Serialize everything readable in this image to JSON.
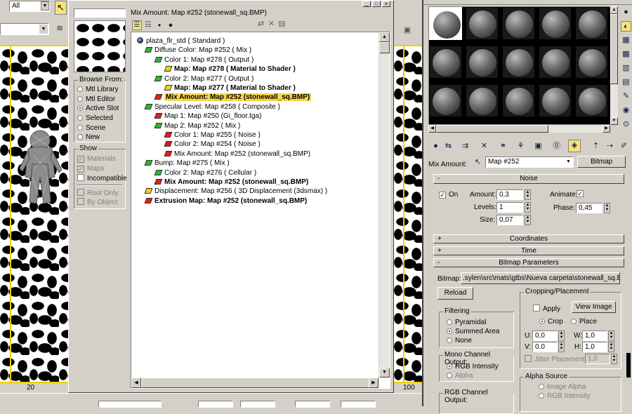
{
  "viewport_toolbar": {
    "filter_value": "All"
  },
  "viewport_left": {
    "ruler_label": "20"
  },
  "viewport_right": {
    "ruler_label": "100"
  },
  "browser": {
    "title": "Mix Amount: Map #252 (stonewall_sq.BMP)",
    "browse_from": {
      "title": "Browse From:",
      "options": [
        "Mtl Library",
        "Mtl Editor",
        "Active Slot",
        "Selected",
        "Scene",
        "New"
      ],
      "selected": "Active Slot"
    },
    "show": {
      "title": "Show",
      "materials": "Materials",
      "maps": "Maps",
      "incompatible": "Incompatible",
      "root_only": "Root Only",
      "by_object": "By Object"
    },
    "tree": [
      {
        "text": "plaza_flr_std  ( Standard )",
        "icon": "blue",
        "bold": false,
        "highlight": false
      },
      {
        "text": "Diffuse Color: Map #252  ( Mix )",
        "icon": "green",
        "bold": false,
        "highlight": false
      },
      {
        "text": "Color 1: Map #278  ( Output )",
        "icon": "green",
        "bold": false,
        "highlight": false
      },
      {
        "text": "Map: Map #278  ( Material to Shader )",
        "icon": "yellow",
        "bold": true,
        "highlight": false
      },
      {
        "text": "Color 2: Map #277  ( Output )",
        "icon": "green",
        "bold": false,
        "highlight": false
      },
      {
        "text": "Map: Map #277  ( Material to Shader )",
        "icon": "yellow",
        "bold": true,
        "highlight": false
      },
      {
        "text": "Mix Amount: Map #252 (stonewall_sq.BMP)",
        "icon": "red",
        "bold": true,
        "highlight": true
      },
      {
        "text": "Specular Level: Map #258  ( Composite )",
        "icon": "green",
        "bold": false,
        "highlight": false
      },
      {
        "text": "Map 1: Map #250 (Gi_floor.tga)",
        "icon": "red",
        "bold": false,
        "highlight": false
      },
      {
        "text": "Map 2: Map #252  ( Mix )",
        "icon": "green",
        "bold": false,
        "highlight": false
      },
      {
        "text": "Color 1: Map #255  ( Noise )",
        "icon": "red",
        "bold": false,
        "highlight": false
      },
      {
        "text": "Color 2: Map #254  ( Noise )",
        "icon": "red",
        "bold": false,
        "highlight": false
      },
      {
        "text": "Mix Amount: Map #252 (stonewall_sq.BMP)",
        "icon": "red",
        "bold": false,
        "highlight": false
      },
      {
        "text": "Bump: Map #275  ( Mix )",
        "icon": "green",
        "bold": false,
        "highlight": false
      },
      {
        "text": "Color 2: Map #276  ( Cellular )",
        "icon": "green",
        "bold": false,
        "highlight": false
      },
      {
        "text": "Mix Amount: Map #252 (stonewall_sq.BMP)",
        "icon": "red",
        "bold": true,
        "highlight": false
      },
      {
        "text": "Displacement: Map #256  ( 3D Displacement (3dsmax) )",
        "icon": "yellow",
        "bold": false,
        "highlight": false
      },
      {
        "text": "Extrusion Map: Map #252 (stonewall_sq.BMP)",
        "icon": "red",
        "bold": true,
        "highlight": false
      }
    ]
  },
  "editor": {
    "mix_amount_label": "Mix Amount:",
    "map_name": "Map #252",
    "map_type_button": "Bitmap",
    "rollouts": {
      "noise": "Noise",
      "coordinates": "Coordinates",
      "time": "Time",
      "bitmap_parameters": "Bitmap Parameters"
    },
    "noise": {
      "on_label": "On",
      "amount_label": "Amount:",
      "amount_value": "0,3",
      "levels_label": "Levels:",
      "levels_value": "1",
      "size_label": "Size:",
      "size_value": "0,07",
      "animate_label": "Animate:",
      "phase_label": "Phase:",
      "phase_value": "0,45"
    },
    "bitmap": {
      "bitmap_label": "Bitmap:",
      "path": ".sylen\\src\\mats\\gtbs\\Nueva carpeta\\stonewall_sq.BMP",
      "reload": "Reload",
      "cropping_title": "Cropping/Placement",
      "apply": "Apply",
      "view_image": "View Image",
      "crop": "Crop",
      "place": "Place",
      "u_label": "U:",
      "u_value": "0,0",
      "w_label": "W:",
      "w_value": "1,0",
      "v_label": "V:",
      "v_value": "0,0",
      "h_label": "H:",
      "h_value": "1,0",
      "jitter_label": "Jitter Placement:",
      "jitter_value": "1,0",
      "filtering_title": "Filtering",
      "filtering_options": [
        "Pyramidal",
        "Summed Area",
        "None"
      ],
      "filtering_selected": "Summed Area",
      "mono_title": "Mono Channel Output:",
      "mono_options": [
        "RGB Intensity",
        "Alpha"
      ],
      "mono_selected": "RGB Intensity",
      "rgb_title": "RGB Channel Output:",
      "alpha_source_title": "Alpha Source",
      "alpha_source_options": [
        "Image Alpha",
        "RGB Intensity"
      ]
    }
  }
}
